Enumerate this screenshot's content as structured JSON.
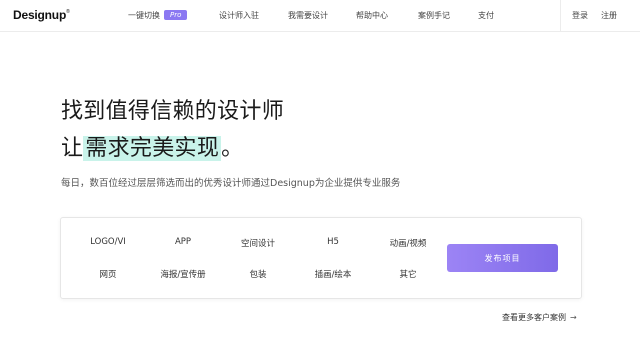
{
  "header": {
    "logo": "Designup",
    "logo_mark": "®",
    "nav": [
      {
        "label": "一键切换",
        "badge": "Pro"
      },
      {
        "label": "设计师入驻"
      },
      {
        "label": "我需要设计"
      },
      {
        "label": "帮助中心"
      },
      {
        "label": "案例手记"
      },
      {
        "label": "支付"
      }
    ],
    "login": "登录",
    "register": "注册"
  },
  "hero": {
    "line1": "找到值得信赖的设计师",
    "line2_prefix": "让",
    "line2_highlight": "需求完美实现",
    "line2_suffix": "。",
    "subtitle": "每日，数百位经过层层筛选而出的优秀设计师通过Designup为企业提供专业服务"
  },
  "categories": {
    "row1": [
      "LOGO/VI",
      "APP",
      "空间设计",
      "H5",
      "动画/视频"
    ],
    "row2": [
      "网页",
      "海报/宣传册",
      "包装",
      "插画/绘本",
      "其它"
    ]
  },
  "cta": {
    "publish": "发布项目",
    "more_cases": "查看更多客户案例",
    "arrow": "→"
  },
  "colors": {
    "accent": "#8b78f2",
    "highlight": "#c9f3ea"
  }
}
